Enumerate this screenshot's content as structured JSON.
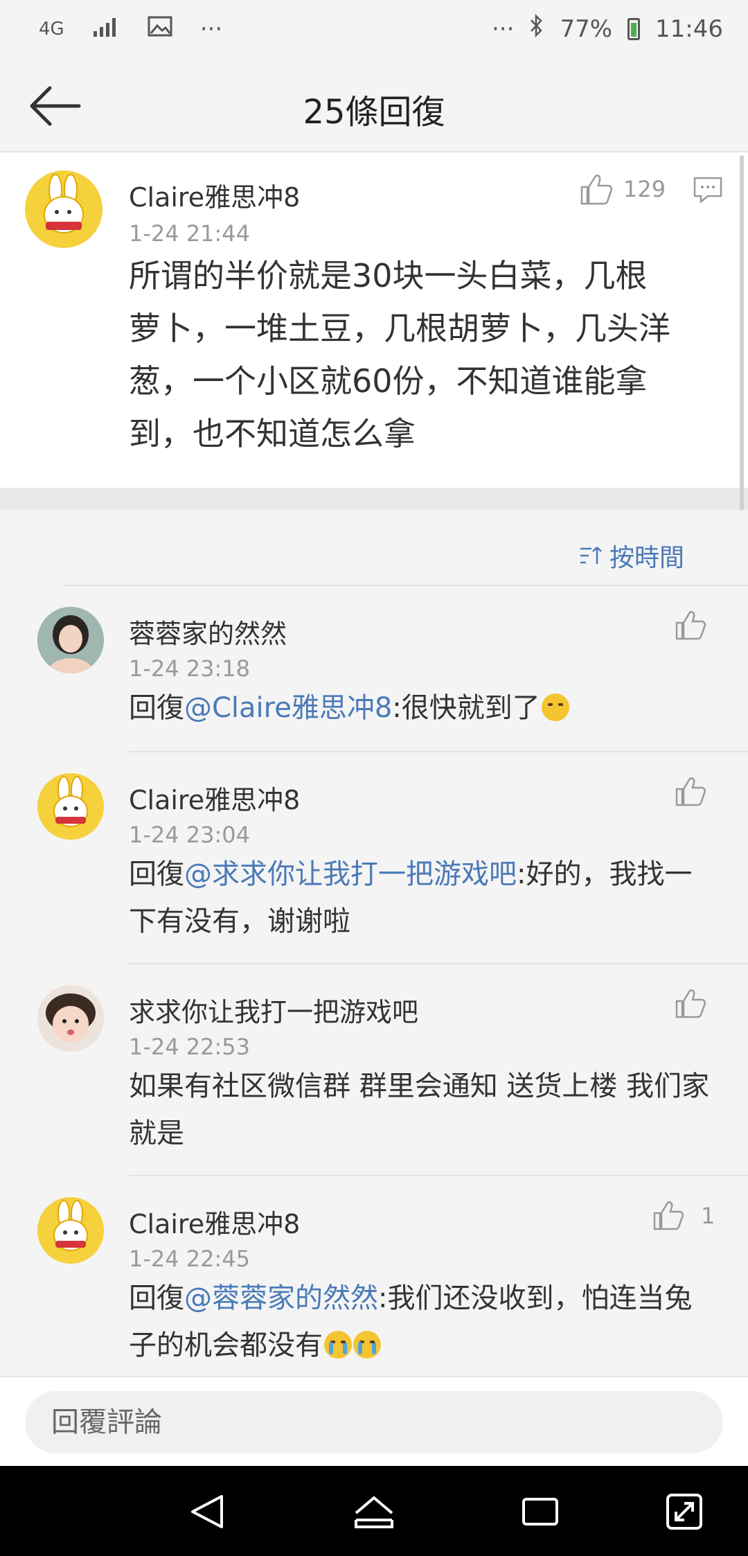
{
  "status_bar": {
    "network": "4G",
    "battery": "77%",
    "time": "11:46"
  },
  "nav": {
    "title": "25條回復"
  },
  "main_comment": {
    "username": "Claire雅思冲8",
    "time": "1-24 21:44",
    "likes": "129",
    "text_lines": [
      "所谓的半价就是30块一头白菜，几根",
      "萝卜，一堆土豆，几根胡萝卜，几头洋",
      "葱，一个小区就60份，不知道谁能拿",
      "到，也不知道怎么拿"
    ]
  },
  "sort": {
    "label": "按時間"
  },
  "replies": [
    {
      "username": "蓉蓉家的然然",
      "time": "1-24 23:18",
      "prefix": "回復",
      "mention": "@Claire雅思冲8",
      "text": ":很快就到了",
      "likes": ""
    },
    {
      "username": "Claire雅思冲8",
      "time": "1-24 23:04",
      "prefix": "回復",
      "mention": "@求求你让我打一把游戏吧",
      "text": ":好的，我找一下有没有，谢谢啦",
      "likes": ""
    },
    {
      "username": "求求你让我打一把游戏吧",
      "time": "1-24 22:53",
      "prefix": "",
      "mention": "",
      "text": "如果有社区微信群 群里会通知 送货上楼 我们家就是",
      "likes": ""
    },
    {
      "username": "Claire雅思冲8",
      "time": "1-24 22:45",
      "prefix": "回復",
      "mention": "@蓉蓉家的然然",
      "text": ":我们还没收到，怕连当兔子的机会都没有",
      "likes": "1"
    }
  ],
  "input": {
    "placeholder": "回覆評論"
  }
}
